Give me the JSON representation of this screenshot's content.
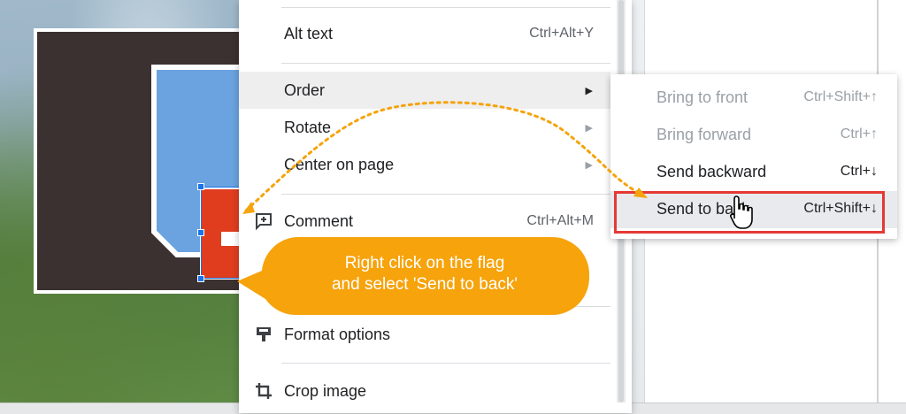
{
  "menu": {
    "items": [
      {
        "label": "Alt text",
        "shortcut": "Ctrl+Alt+Y"
      },
      {
        "label": "Order",
        "submenu": true
      },
      {
        "label": "Rotate",
        "submenu": true
      },
      {
        "label": "Center on page",
        "submenu": true
      },
      {
        "label": "Comment",
        "shortcut": "Ctrl+Alt+M",
        "icon": "add-comment-icon"
      },
      {
        "label": "Format options",
        "icon": "format-options-icon"
      },
      {
        "label": "Crop image",
        "icon": "crop-icon"
      }
    ]
  },
  "submenu": {
    "items": [
      {
        "label": "Bring to front",
        "shortcut": "Ctrl+Shift+↑",
        "enabled": false
      },
      {
        "label": "Bring forward",
        "shortcut": "Ctrl+↑",
        "enabled": false
      },
      {
        "label": "Send backward",
        "shortcut": "Ctrl+↓",
        "enabled": true
      },
      {
        "label": "Send to back",
        "shortcut": "Ctrl+Shift+↓",
        "enabled": true,
        "hovered": true
      }
    ]
  },
  "callout": {
    "line1": "Right click on the flag",
    "line2": "and select 'Send to back'"
  },
  "colors": {
    "callout": "#f6a30c",
    "highlight": "#e53935",
    "selection": "#1a73e8",
    "flag_red": "#e03d1f",
    "flag_blue": "#6aa3e0",
    "flag_dark": "#3b3130"
  }
}
